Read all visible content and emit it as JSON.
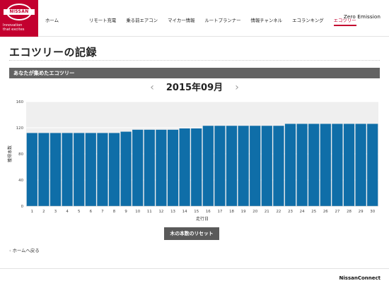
{
  "brand": {
    "logo_text": "NISSAN",
    "tagline_line1": "Innovation",
    "tagline_line2": "that excites",
    "color": "#c3002f"
  },
  "nav": {
    "items": [
      {
        "label": "ホーム",
        "active": false
      },
      {
        "label": "リモート充電",
        "active": false
      },
      {
        "label": "乗る前エアコン",
        "active": false
      },
      {
        "label": "マイカー情報",
        "active": false
      },
      {
        "label": "ルートプランナー",
        "active": false
      },
      {
        "label": "情報チャンネル",
        "active": false
      },
      {
        "label": "エコランキング",
        "active": false
      },
      {
        "label": "エコツリー",
        "active": true
      }
    ],
    "zero_emission": "Zero Emission"
  },
  "page": {
    "title": "エコツリーの記録",
    "section_label": "あなたが集めたエコツリー",
    "month": "2015年09月",
    "prev_icon": "chevron-left-icon",
    "next_icon": "chevron-right-icon",
    "reset_label": "木の本数のリセット",
    "back_label": "ホームへ戻る",
    "footer_brand": "NissanConnect"
  },
  "chart_data": {
    "type": "bar",
    "categories": [
      "1",
      "2",
      "3",
      "4",
      "5",
      "6",
      "7",
      "8",
      "9",
      "10",
      "11",
      "12",
      "13",
      "14",
      "15",
      "16",
      "17",
      "18",
      "19",
      "20",
      "21",
      "22",
      "23",
      "24",
      "25",
      "26",
      "27",
      "28",
      "29",
      "30"
    ],
    "values": [
      112,
      112,
      112,
      112,
      112,
      112,
      112,
      112,
      114,
      117,
      117,
      117,
      117,
      119,
      119,
      123,
      123,
      123,
      123,
      123,
      123,
      123,
      126,
      126,
      126,
      126,
      126,
      126,
      126,
      126
    ],
    "xlabel": "走行日",
    "ylabel": "獲得本数",
    "ylim": [
      0,
      160
    ],
    "yticks": [
      0,
      40,
      80,
      120,
      160
    ],
    "bar_color": "#0f6ea8",
    "plot_bg": "#efefef",
    "grid": true
  }
}
